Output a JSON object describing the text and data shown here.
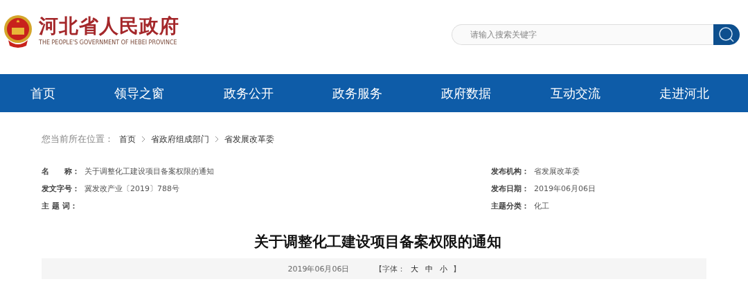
{
  "header": {
    "site_name": "河北省人民政府",
    "site_name_en": "THE PEOPLE'S GOVERNMENT OF HEBEI PROVINCE"
  },
  "search": {
    "placeholder": "请输入搜索关键字"
  },
  "nav": [
    {
      "label": "首页"
    },
    {
      "label": "领导之窗"
    },
    {
      "label": "政务公开"
    },
    {
      "label": "政务服务"
    },
    {
      "label": "政府数据"
    },
    {
      "label": "互动交流"
    },
    {
      "label": "走进河北"
    }
  ],
  "breadcrumb": {
    "label": "您当前所在位置：",
    "items": [
      "首页",
      "省政府组成部门",
      "省发展改革委"
    ]
  },
  "meta_left": [
    {
      "label": "名　　称：",
      "value": "关于调整化工建设项目备案权限的通知"
    },
    {
      "label": "发文字号：",
      "value": "冀发改产业〔2019〕788号"
    },
    {
      "label": "主 题 词："
    }
  ],
  "meta_right": [
    {
      "label": "发布机构：",
      "value": "省发展改革委"
    },
    {
      "label": "发布日期：",
      "value": "2019年06月06日"
    },
    {
      "label": "主题分类：",
      "value": "化工"
    }
  ],
  "article": {
    "title": "关于调整化工建设项目备案权限的通知",
    "date": "2019年06月06日",
    "font_label": "【字体：",
    "font_sizes": [
      "大",
      "中",
      "小"
    ],
    "font_close": "】"
  }
}
